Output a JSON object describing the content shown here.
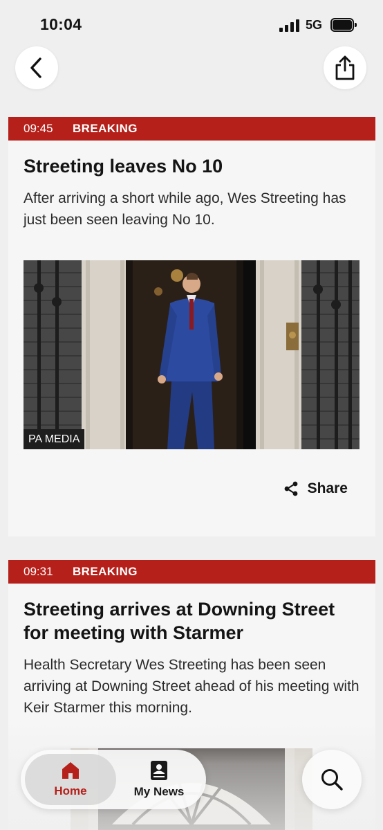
{
  "status_bar": {
    "time": "10:04",
    "network": "5G"
  },
  "nav": {
    "back_icon": "chevron-left-icon",
    "share_icon": "share-upload-icon"
  },
  "posts": [
    {
      "time": "09:45",
      "label": "BREAKING",
      "title": "Streeting leaves No 10",
      "body": "After arriving a short while ago, Wes Streeting has just been seen leaving No 10.",
      "image_credit": "PA MEDIA",
      "share_label": "Share"
    },
    {
      "time": "09:31",
      "label": "BREAKING",
      "title": "Streeting arrives at Downing Street for meeting with Starmer",
      "body": "Health Secretary Wes Streeting has been seen arriving at Downing Street ahead of his meeting with Keir Starmer this morning."
    }
  ],
  "tabs": [
    {
      "label": "Home",
      "icon": "home-icon",
      "active": true
    },
    {
      "label": "My News",
      "icon": "my-news-icon",
      "active": false
    }
  ],
  "colors": {
    "accent": "#b5201a",
    "background": "#efefef",
    "card": "#f6f6f6"
  }
}
